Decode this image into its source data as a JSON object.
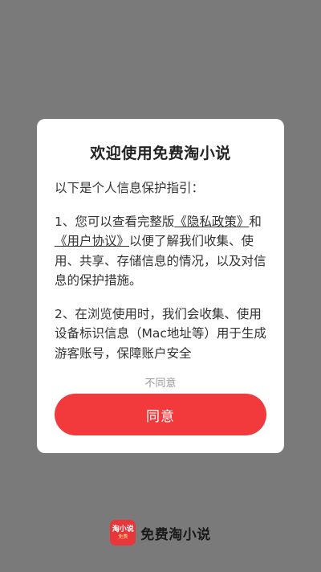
{
  "dialog": {
    "title": "欢迎使用免费淘小说",
    "intro": "以下是个人信息保护指引：",
    "para1_prefix": "1、您可以查看完整版",
    "privacy_link": "《隐私政策》",
    "para1_and": "和",
    "agreement_link": "《用户协议》",
    "para1_suffix": "以便了解我们收集、使用、共享、存储信息的情况，以及对信息的保护措施。",
    "para2": "2、在浏览使用时，我们会收集、使用设备标识信息（Mac地址等）用于生成游客账号，保障账户安全",
    "disagree_label": "不同意",
    "agree_label": "同意"
  },
  "brand": {
    "icon_text": "淘小说",
    "icon_sub": "免费",
    "app_name": "免费淘小说"
  },
  "colors": {
    "overlay": "#7a7a7a",
    "accent": "#f23a3d"
  }
}
